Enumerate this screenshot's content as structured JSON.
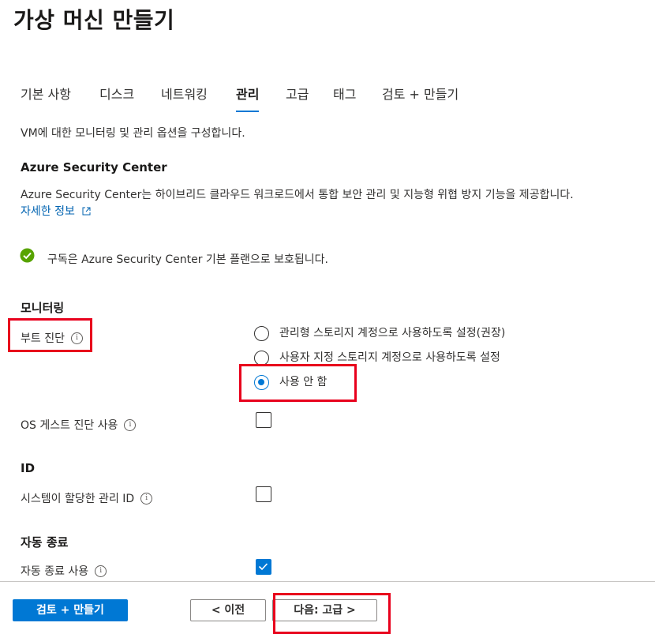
{
  "page": {
    "title": "가상 머신 만들기"
  },
  "tabs": [
    {
      "label": "기본 사항"
    },
    {
      "label": "디스크"
    },
    {
      "label": "네트워킹"
    },
    {
      "label": "관리",
      "active": true
    },
    {
      "label": "고급"
    },
    {
      "label": "태그"
    },
    {
      "label": "검토 + 만들기"
    }
  ],
  "intro": {
    "text": "VM에 대한 모니터링 및 관리 옵션을 구성합니다."
  },
  "security_center": {
    "heading": "Azure Security Center",
    "description": "Azure Security Center는 하이브리드 클라우드 워크로드에서 통합 보안 관리 및 지능형 위협 방지 기능을 제공합니다.",
    "learn_more": "자세한 정보",
    "status_text": "구독은 Azure Security Center 기본 플랜으로 보호됩니다."
  },
  "monitoring": {
    "heading": "모니터링",
    "boot_diagnostics": {
      "label": "부트 진단",
      "options": [
        {
          "label": "관리형 스토리지 계정으로 사용하도록 설정(권장)",
          "selected": false
        },
        {
          "label": "사용자 지정 스토리지 계정으로 사용하도록 설정",
          "selected": false
        },
        {
          "label": "사용 안 함",
          "selected": true
        }
      ]
    },
    "os_guest": {
      "label": "OS 게스트 진단 사용",
      "checked": false
    }
  },
  "identity": {
    "heading": "ID",
    "system_assigned": {
      "label": "시스템이 할당한 관리 ID",
      "checked": false
    }
  },
  "auto_shutdown": {
    "heading": "자동 종료",
    "enable": {
      "label": "자동 종료 사용",
      "checked": true
    }
  },
  "footer": {
    "review_create": "검토 + 만들기",
    "previous": "< 이전",
    "next": "다음: 고급 >"
  },
  "colors": {
    "accent": "#0078d4",
    "success": "#57a300",
    "highlight": "#e8001c"
  }
}
